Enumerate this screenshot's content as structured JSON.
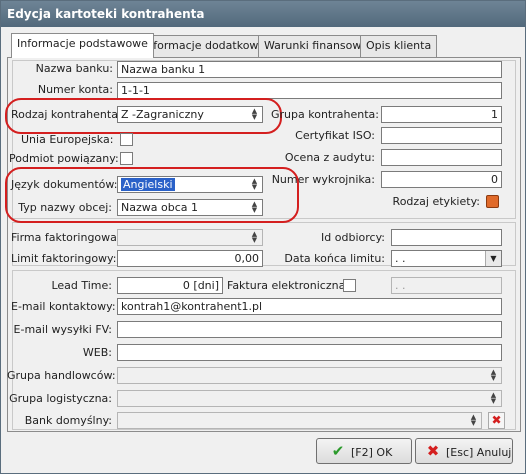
{
  "window": {
    "title": "Edycja kartoteki kontrahenta"
  },
  "tabs": [
    {
      "label": "Informacje podstawowe"
    },
    {
      "label": "Informacje dodatkowe"
    },
    {
      "label": "Warunki finansowe"
    },
    {
      "label": "Opis klienta"
    }
  ],
  "bank": {
    "name_label": "Nazwa banku:",
    "name_value": "Nazwa banku 1",
    "account_label": "Numer konta:",
    "account_value": "1-1-1"
  },
  "contractor": {
    "type_label": "Rodzaj kontrahenta:",
    "type_value": "Z -Zagraniczny",
    "eu_label": "Unia Europejska:",
    "related_label": "Podmiot powiązany:",
    "group_label": "Grupa kontrahenta:",
    "group_value": "1",
    "iso_label": "Certyfikat ISO:",
    "audit_label": "Ocena z audytu:",
    "die_label": "Numer wykrojnika:",
    "die_value": "0",
    "label_type_label": "Rodzaj etykiety:",
    "doc_lang_label": "Język dokumentów:",
    "doc_lang_value": "Angielski",
    "foreign_name_label": "Typ nazwy obcej:",
    "foreign_name_value": "Nazwa obca 1"
  },
  "factoring": {
    "company_label": "Firma faktoringowa:",
    "limit_label": "Limit faktoringowy:",
    "limit_value": "0,00",
    "recipient_label": "Id odbiorcy:",
    "limit_end_label": "Data końca limitu:",
    "limit_end_value": "  .  ."
  },
  "other": {
    "lead_label": "Lead Time:",
    "lead_value": "0 [dni]",
    "einvoice_label": "Faktura elektroniczna:",
    "einvoice_date": "  .  .",
    "email_label": "E-mail kontaktowy:",
    "email_value": "kontrah1@kontrahent1.pl",
    "email_fv_label": "E-mail wysyłki FV:",
    "web_label": "WEB:",
    "trade_group_label": "Grupa handlowców:",
    "logistic_group_label": "Grupa logistyczna:",
    "bank_default_label": "Bank domyślny:"
  },
  "buttons": {
    "ok": "[F2] OK",
    "cancel": "[Esc] Anuluj"
  },
  "colors": {
    "highlight_oval": "#d41f1f",
    "label_swatch": "#e06a2a"
  }
}
